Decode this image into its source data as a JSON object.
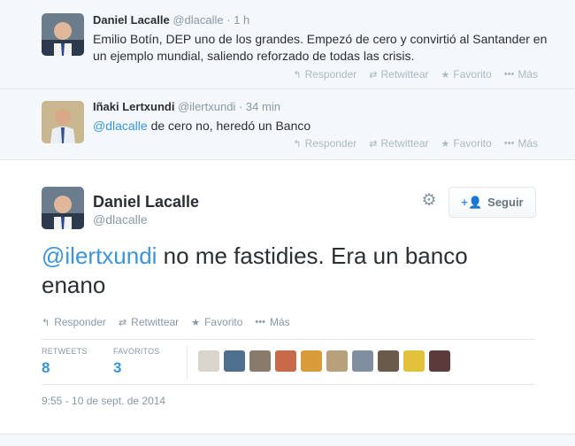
{
  "tweet1": {
    "name": "Daniel Lacalle",
    "handle": "@dlacalle",
    "sep": "·",
    "time": "1 h",
    "text": "Emilio Botín, DEP uno de los grandes. Empezó de cero y convirtió al Santander en un ejemplo mundial, saliendo reforzado de todas las crisis.",
    "actions": {
      "reply": "Responder",
      "retweet": "Retwittear",
      "favorite": "Favorito",
      "more": "Más"
    }
  },
  "tweet2": {
    "name": "Iñaki Lertxundi",
    "handle": "@ilertxundi",
    "sep": "·",
    "time": "34 min",
    "mention": "@dlacalle",
    "text": " de cero no, heredó un Banco",
    "actions": {
      "reply": "Responder",
      "retweet": "Retwittear",
      "favorite": "Favorito",
      "more": "Más"
    }
  },
  "main": {
    "name": "Daniel Lacalle",
    "handle": "@dlacalle",
    "follow_label": "Seguir",
    "mention": "@ilertxundi",
    "text": " no me fastidies. Era un banco enano",
    "actions": {
      "reply": "Responder",
      "retweet": "Retwittear",
      "favorite": "Favorito",
      "more": "Más"
    },
    "stats": {
      "retweets_label": "RETWEETS",
      "retweets": "8",
      "favorites_label": "FAVORITOS",
      "favorites": "3"
    },
    "timestamp": "9:55 - 10 de sept. de 2014"
  },
  "icons": {
    "reply": "reply-icon",
    "retweet": "retweet-icon",
    "favorite": "star-icon",
    "more": "more-dots-icon",
    "gear": "gear-icon",
    "follow": "add-person-icon"
  },
  "colors": {
    "link": "#3b94d9",
    "muted": "#8899a6",
    "text": "#292f33",
    "bg_context": "#f5f8fa"
  }
}
